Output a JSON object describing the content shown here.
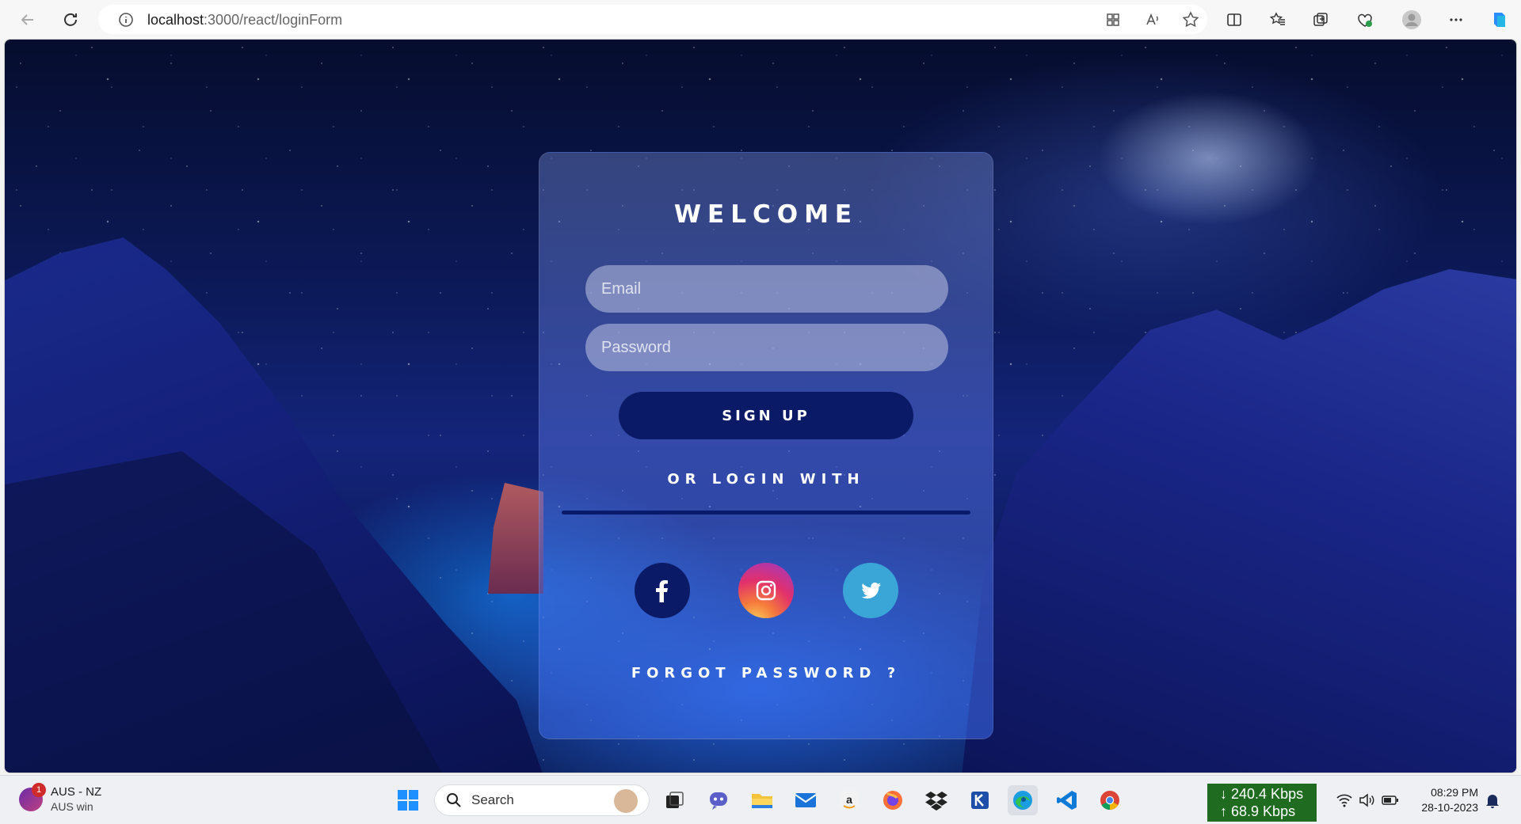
{
  "browser": {
    "url_host": "localhost",
    "url_path": ":3000/react/loginForm"
  },
  "login": {
    "title": "WELCOME",
    "email_placeholder": "Email",
    "password_placeholder": "Password",
    "signup_label": "SIGN UP",
    "or_login_label": "OR LOGIN WITH",
    "forgot_label": "FORGOT PASSWORD ?",
    "social": [
      "facebook-icon",
      "instagram-icon",
      "twitter-icon"
    ]
  },
  "taskbar": {
    "weather_title": "AUS - NZ",
    "weather_sub": "AUS win",
    "weather_badge": "1",
    "search_label": "Search",
    "net_down": "240.4 Kbps",
    "net_up": "68.9 Kbps",
    "time": "08:29 PM",
    "date": "28-10-2023"
  },
  "colors": {
    "signup_button": "#0b1a66",
    "facebook": "#0b1a66",
    "twitter": "#3aa6d8",
    "net_box": "#1f6b20"
  }
}
